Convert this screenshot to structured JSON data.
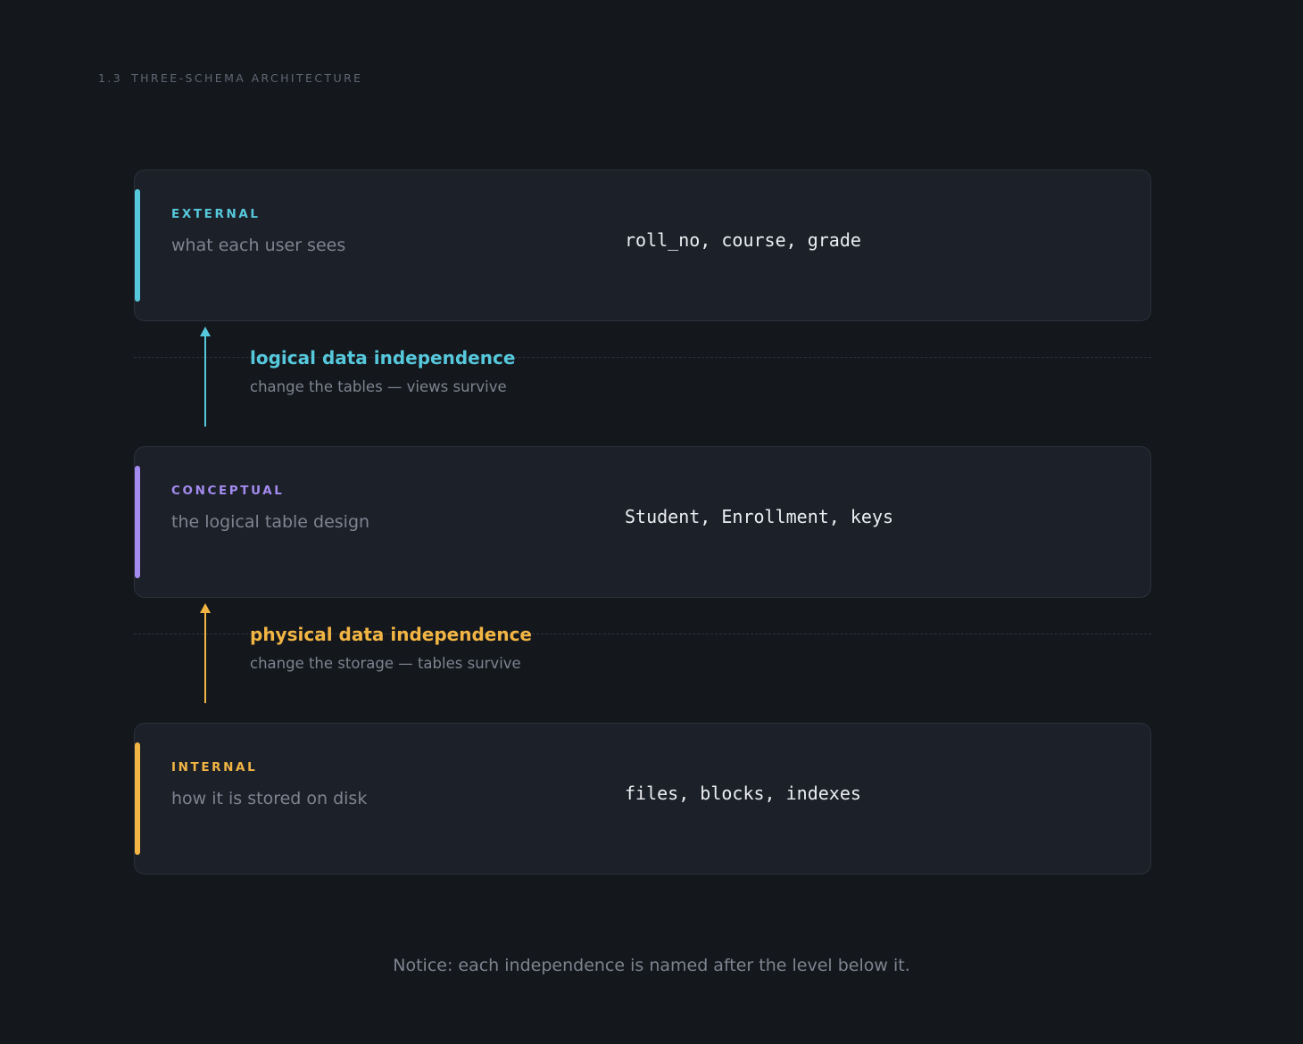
{
  "header": {
    "number": "1.3",
    "title": "THREE-SCHEMA ARCHITECTURE"
  },
  "colors": {
    "external": "#56c8dc",
    "conceptual": "#a48bef",
    "internal": "#f2b544"
  },
  "levels": [
    {
      "name": "EXTERNAL",
      "description": "what each user sees",
      "example": "roll_no, course, grade"
    },
    {
      "name": "CONCEPTUAL",
      "description": "the logical table design",
      "example": "Student, Enrollment, keys"
    },
    {
      "name": "INTERNAL",
      "description": "how it is stored on disk",
      "example": "files, blocks, indexes"
    }
  ],
  "independence": [
    {
      "title": "logical data independence",
      "note": "change the tables — views survive"
    },
    {
      "title": "physical data independence",
      "note": "change the storage — tables survive"
    }
  ],
  "footnote": "Notice: each independence is named after the level below it."
}
